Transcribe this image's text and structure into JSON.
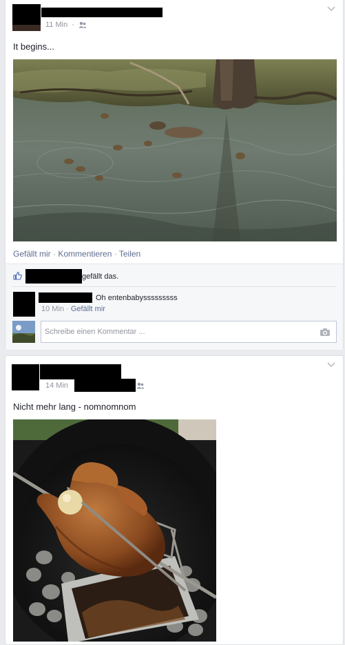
{
  "posts": [
    {
      "time": "11 Min",
      "privacy_icon": "friends-icon",
      "text": "It begins...",
      "photo_alt": "ducklings-swimming-in-pond",
      "actions": {
        "like": "Gefällt mir",
        "comment": "Kommentieren",
        "share": "Teilen",
        "separator": " · "
      },
      "likes_text": "gefällt das.",
      "comment": {
        "text": "Oh entenbabysssssssss",
        "time": "10 Min",
        "like": "Gefällt mir",
        "separator": " · "
      },
      "composer_placeholder": "Schreibe einen Kommentar ..."
    },
    {
      "time": "14 Min",
      "privacy_icon": "friends-icon",
      "text": "Nicht mehr lang - nomnomnom",
      "photo_alt": "chicken-on-rotisserie-grill"
    }
  ]
}
